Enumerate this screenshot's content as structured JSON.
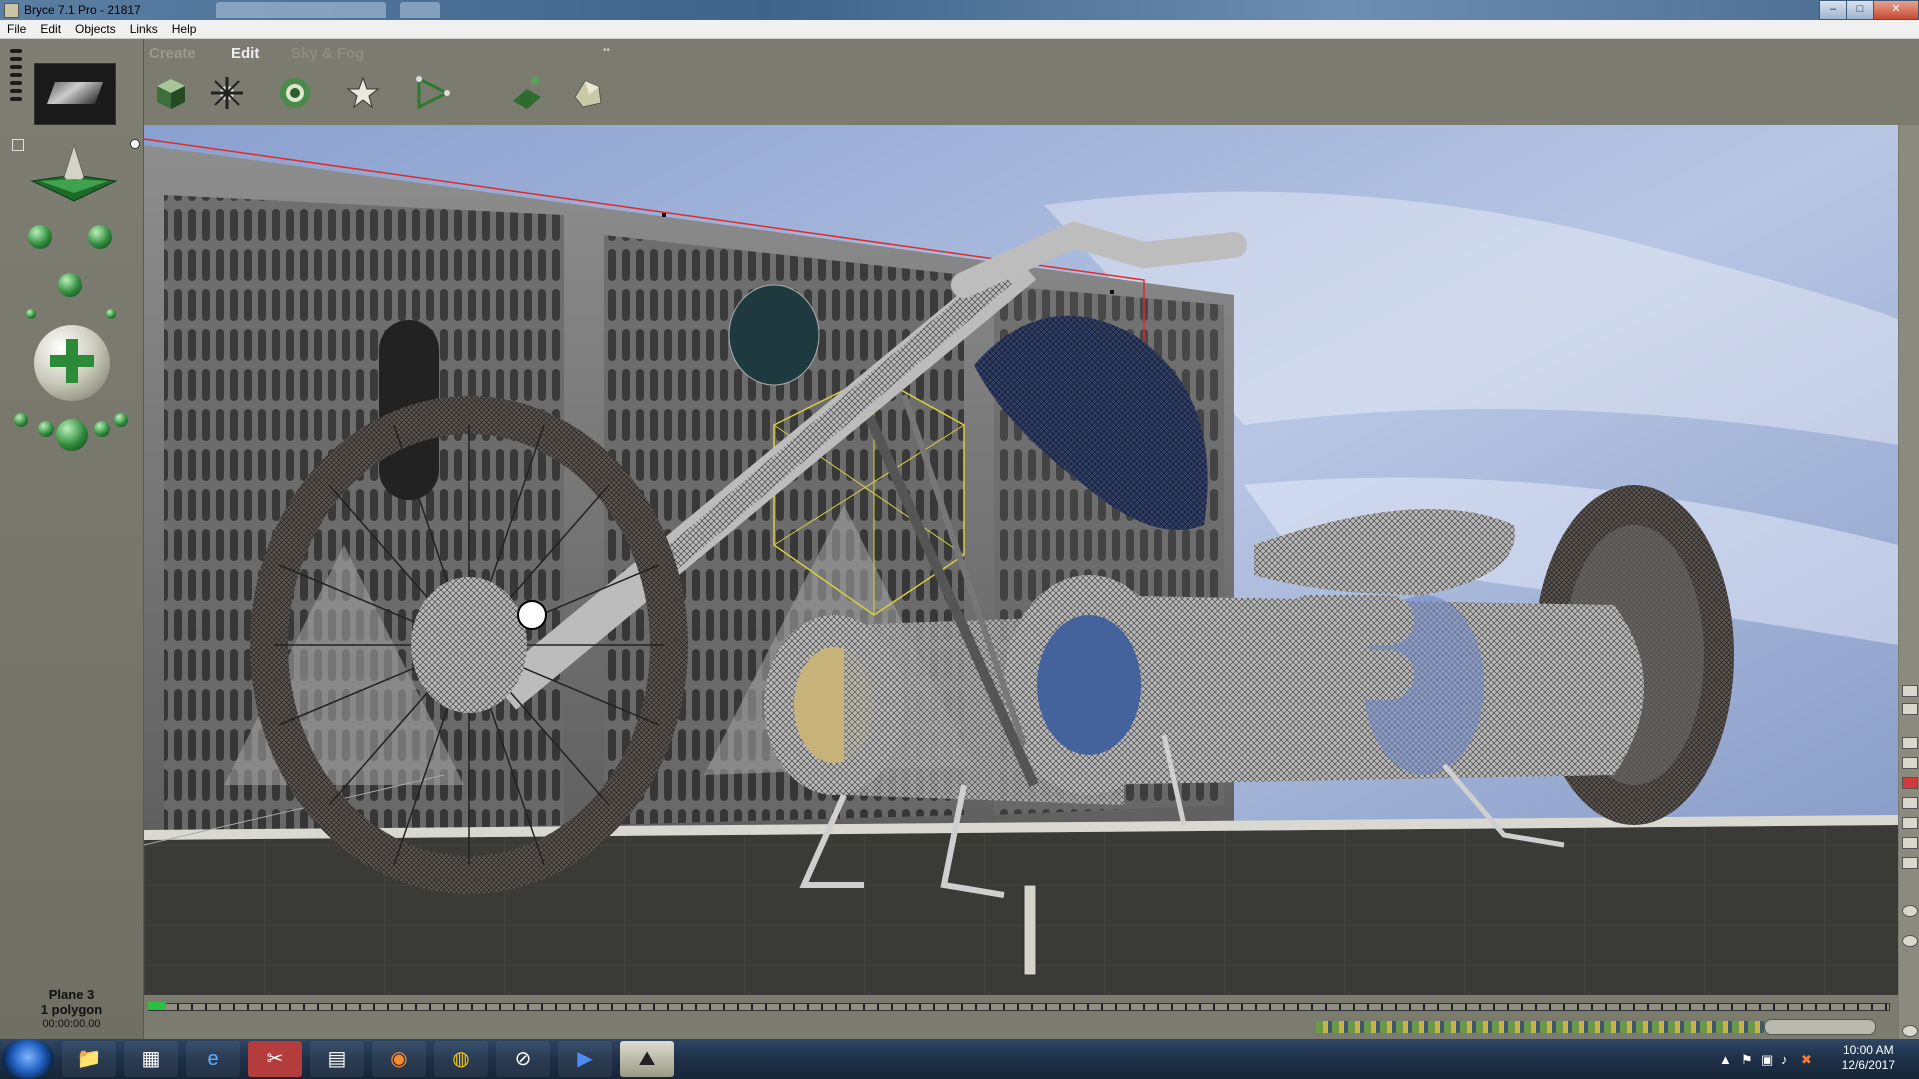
{
  "window": {
    "title": "Bryce 7.1  Pro - 21817",
    "minimize": "–",
    "maximize": "□",
    "close": "✕"
  },
  "menu": {
    "items": [
      "File",
      "Edit",
      "Objects",
      "Links",
      "Help"
    ]
  },
  "palette_tabs": {
    "create": "Create",
    "edit": "Edit",
    "sky_fog": "Sky & Fog"
  },
  "tools": [
    {
      "name": "cube-primitive-icon"
    },
    {
      "name": "burst-primitive-icon"
    },
    {
      "name": "torus-primitive-icon"
    },
    {
      "name": "star-primitive-icon"
    },
    {
      "name": "path-primitive-icon"
    },
    {
      "name": "grid-terrain-icon"
    },
    {
      "name": "rock-primitive-icon"
    }
  ],
  "selection": {
    "name": "Plane 3",
    "info": "1 polygon",
    "time": "00:00:00.00"
  },
  "taskbar": {
    "apps": [
      {
        "name": "file-explorer",
        "glyph": "📁"
      },
      {
        "name": "calculator",
        "glyph": "▦"
      },
      {
        "name": "internet-explorer",
        "glyph": "e"
      },
      {
        "name": "snipping-tool",
        "glyph": "✂"
      },
      {
        "name": "notepad",
        "glyph": "▤"
      },
      {
        "name": "firefox",
        "glyph": "◉"
      },
      {
        "name": "chrome",
        "glyph": "◍"
      },
      {
        "name": "satellite-app",
        "glyph": "⊘"
      },
      {
        "name": "media-player",
        "glyph": "▶"
      },
      {
        "name": "bryce",
        "glyph": "⛰"
      }
    ],
    "clock_time": "10:00 AM",
    "clock_date": "12/6/2017"
  },
  "colors": {
    "panel": "#7b7b6f",
    "accent_green": "#2f8a3c",
    "selection_red": "#e02a2a",
    "wire_yellow": "#d8d040",
    "sky_blue": "#8fa8d4"
  }
}
